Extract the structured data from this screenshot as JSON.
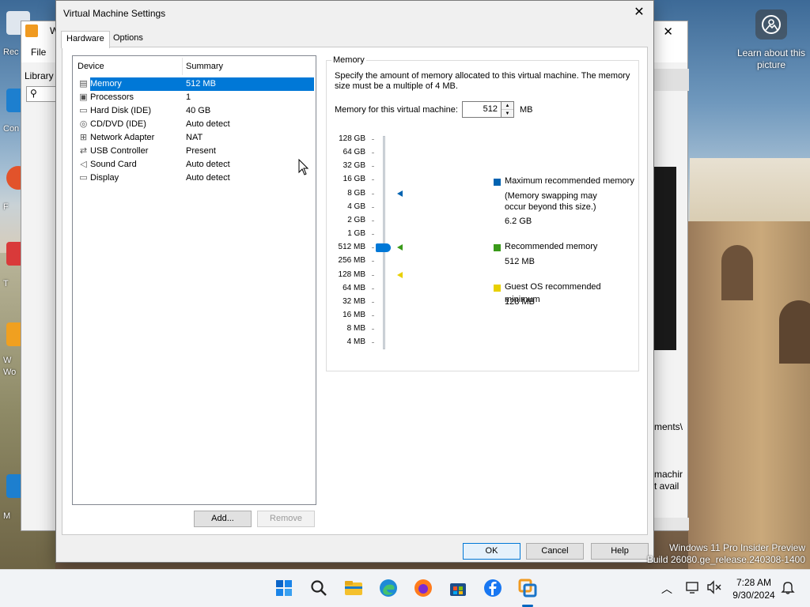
{
  "desktop": {
    "learn_label": "Learn about this picture",
    "icon_labels": [
      "Rec",
      "Con",
      "F",
      "T",
      "W",
      "Wo",
      "M"
    ],
    "watermark_line1": "Windows 11 Pro Insider Preview",
    "watermark_line2": "Build 26080.ge_release.240308-1400"
  },
  "background_window": {
    "title_fragment": "W",
    "menu_file": "File",
    "library_label": "Library",
    "text_fragment1": "ments\\",
    "text_fragment2_line1": "machir",
    "text_fragment2_line2": "t avail"
  },
  "dialog": {
    "title": "Virtual Machine Settings",
    "close_glyph": "✕",
    "tabs": [
      {
        "label": "Hardware",
        "active": true
      },
      {
        "label": "Options",
        "active": false
      }
    ],
    "device_list": {
      "header_device": "Device",
      "header_summary": "Summary",
      "items": [
        {
          "icon": "memory-icon",
          "glyph": "▤",
          "name": "Memory",
          "summary": "512 MB",
          "selected": true
        },
        {
          "icon": "processor-icon",
          "glyph": "▣",
          "name": "Processors",
          "summary": "1",
          "selected": false
        },
        {
          "icon": "hard-disk-icon",
          "glyph": "▭",
          "name": "Hard Disk (IDE)",
          "summary": "40 GB",
          "selected": false
        },
        {
          "icon": "cd-dvd-icon",
          "glyph": "◎",
          "name": "CD/DVD (IDE)",
          "summary": "Auto detect",
          "selected": false
        },
        {
          "icon": "network-adapter-icon",
          "glyph": "⊞",
          "name": "Network Adapter",
          "summary": "NAT",
          "selected": false
        },
        {
          "icon": "usb-controller-icon",
          "glyph": "⇄",
          "name": "USB Controller",
          "summary": "Present",
          "selected": false
        },
        {
          "icon": "sound-card-icon",
          "glyph": "◁",
          "name": "Sound Card",
          "summary": "Auto detect",
          "selected": false
        },
        {
          "icon": "display-icon",
          "glyph": "▭",
          "name": "Display",
          "summary": "Auto detect",
          "selected": false
        }
      ]
    },
    "add_button": "Add...",
    "remove_button": "Remove",
    "memory": {
      "group_title": "Memory",
      "description": "Specify the amount of memory allocated to this virtual machine. The memory size must be a multiple of 4 MB.",
      "field_label": "Memory for this virtual machine:",
      "value": "512",
      "unit": "MB",
      "scale_labels": [
        "128 GB",
        "64 GB",
        "32 GB",
        "16 GB",
        "8 GB",
        "4 GB",
        "2 GB",
        "1 GB",
        "512 MB",
        "256 MB",
        "128 MB",
        "64 MB",
        "32 MB",
        "16 MB",
        "8 MB",
        "4 MB"
      ],
      "current_level": "512 MB",
      "legend": [
        {
          "name": "max",
          "color": "#0063b1",
          "label": "Maximum recommended memory",
          "note": "(Memory swapping may occur beyond this size.)",
          "value": "6.2 GB",
          "marker_level": "8 GB"
        },
        {
          "name": "recommended",
          "color": "#3a9a1a",
          "label": "Recommended memory",
          "value": "512 MB",
          "marker_level": "512 MB"
        },
        {
          "name": "minimum",
          "color": "#e8d000",
          "label": "Guest OS recommended minimum",
          "value": "128 MB",
          "marker_level": "128 MB"
        }
      ]
    },
    "ok_button": "OK",
    "cancel_button": "Cancel",
    "help_button": "Help"
  },
  "taskbar": {
    "icons": [
      "windows-start-icon",
      "search-icon",
      "file-explorer-icon",
      "edge-icon",
      "firefox-icon",
      "store-icon",
      "facebook-icon",
      "vmware-icon"
    ],
    "time": "7:28 AM",
    "date": "9/30/2024"
  }
}
